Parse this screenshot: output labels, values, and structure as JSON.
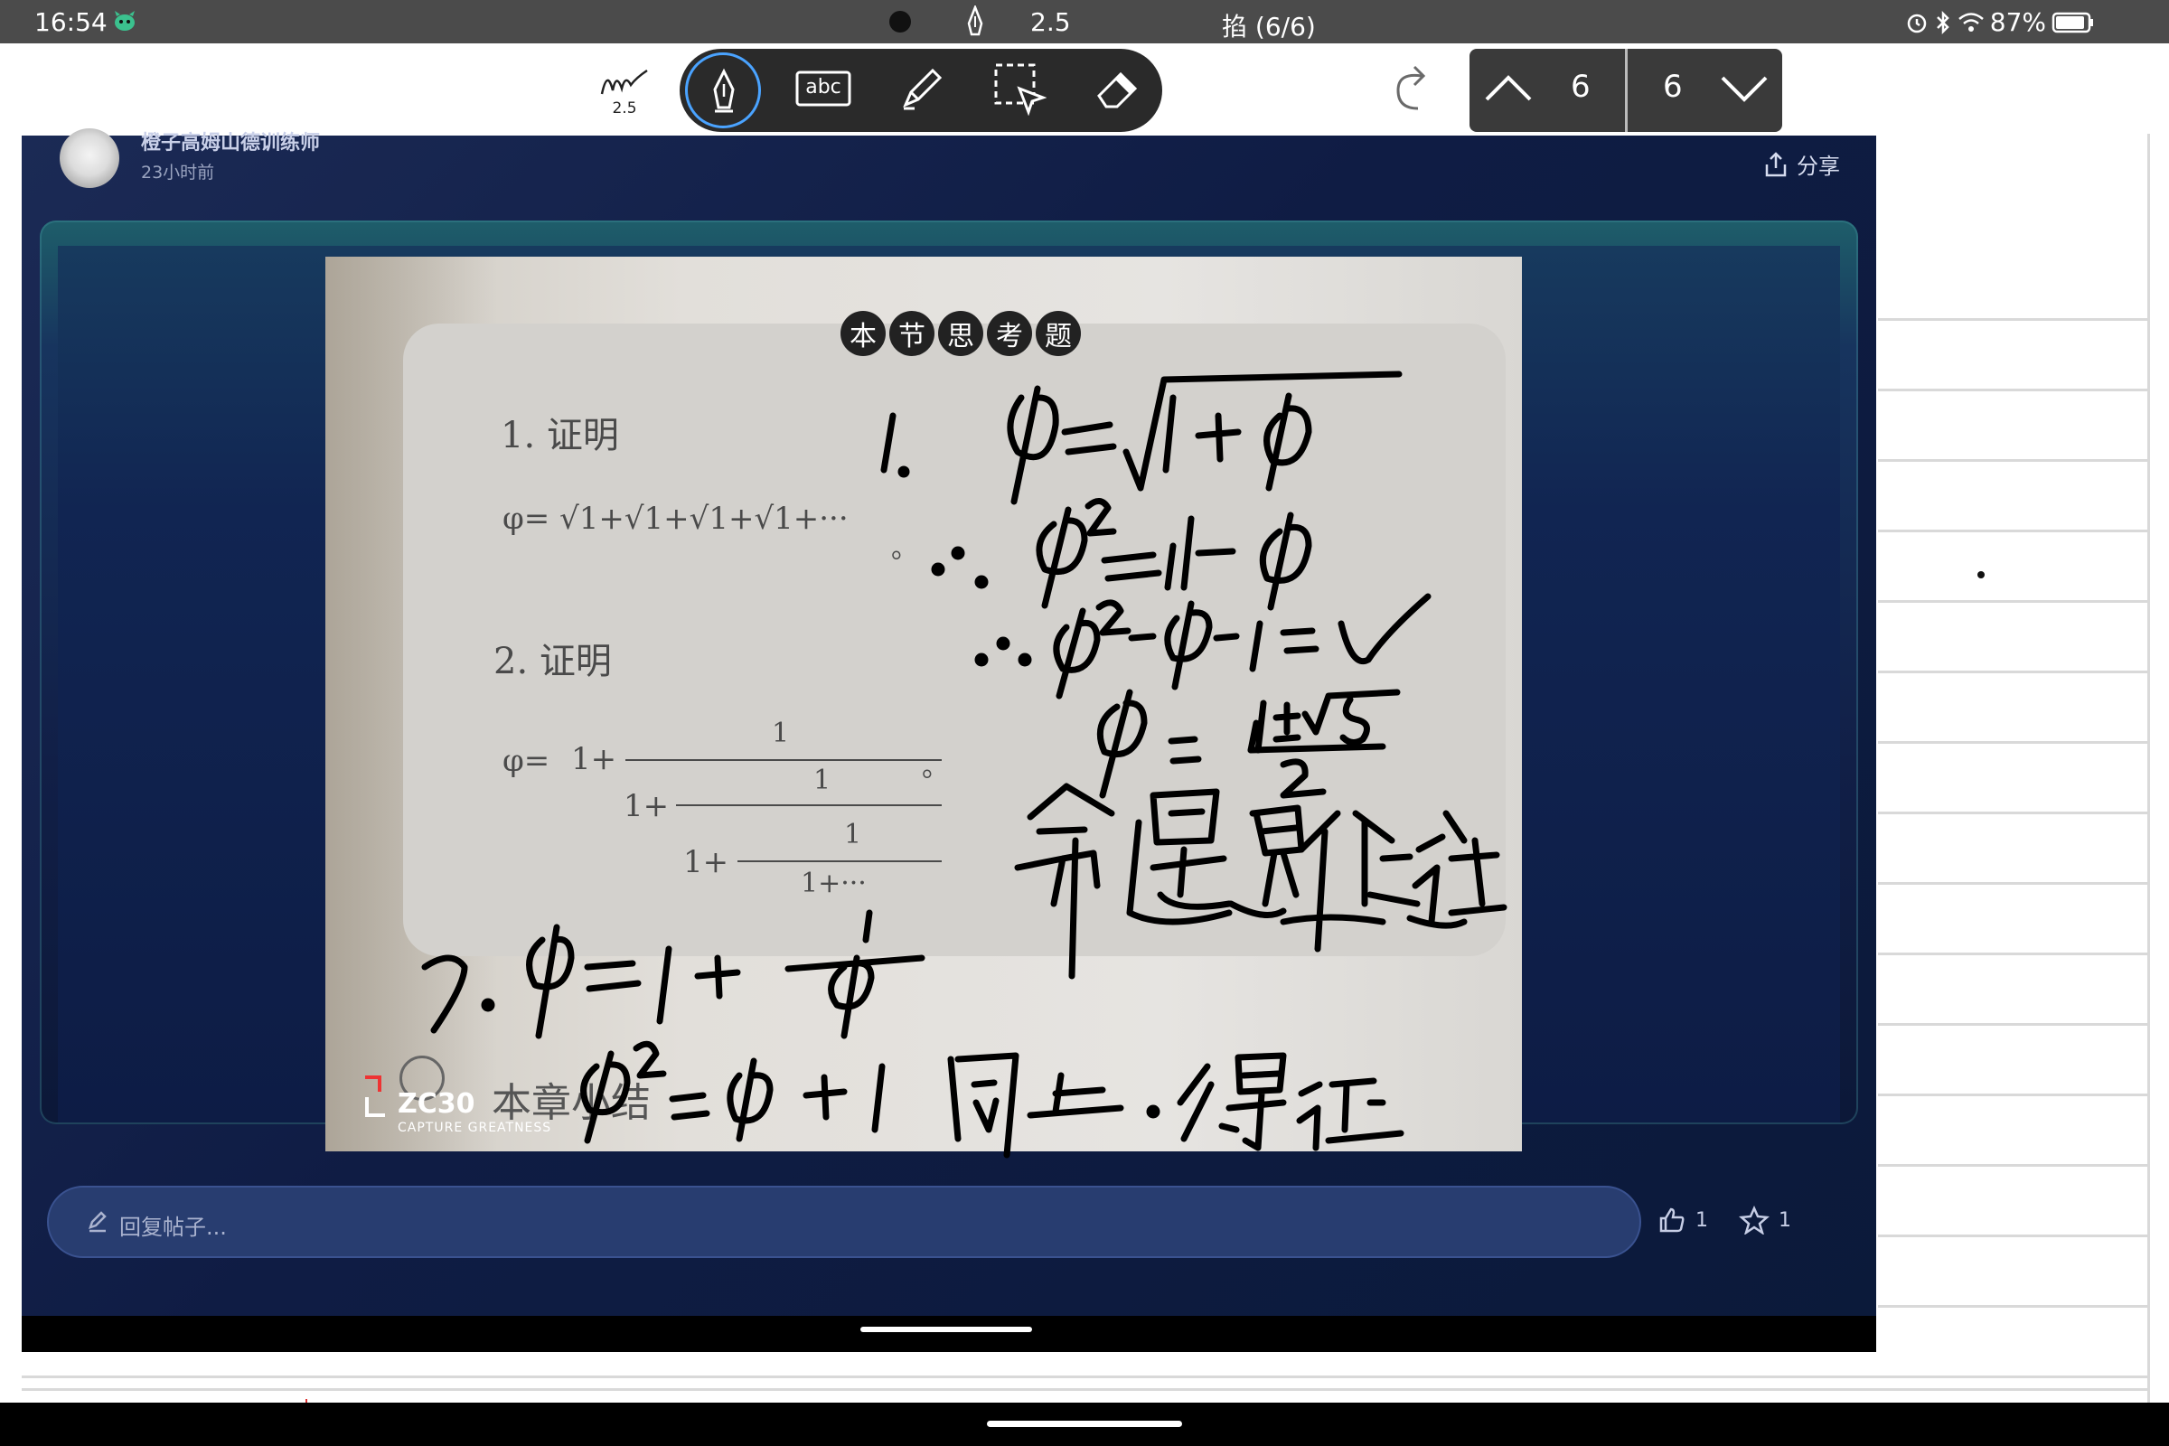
{
  "status_bar": {
    "time": "16:54",
    "pen_size": "2.5",
    "page_indicator": "掐 (6/6)",
    "battery": "87%"
  },
  "toolbar": {
    "pen_size_badge": "2.5",
    "text_tool_label": "abc",
    "current_page": "6",
    "total_pages": "6"
  },
  "post": {
    "author": "橙子高姆山德训练师",
    "time_ago": "23小时前",
    "share_label": "分享",
    "reply_placeholder": "回复帖子...",
    "likes": "1",
    "favorites": "1"
  },
  "photo": {
    "heading_chars": [
      "本",
      "节",
      "思",
      "考",
      "题"
    ],
    "q1_label": "1. 证明",
    "q1_formula": "φ= √1+√1+√1+√1+···",
    "q2_label": "2. 证明",
    "q2_phi": "φ=",
    "q2_one_plus": "1+",
    "q2_one": "1",
    "q2_one_plus_b": "1+",
    "q2_one_b": "1",
    "q2_one_plus_c": "1+",
    "q2_one_c": "1",
    "q2_tail": "1+···",
    "circle_mark": "。",
    "chapter_summary": "本章小结",
    "camera_brand": "ZC30",
    "camera_tagline": "CAPTURE GREATNESS"
  },
  "colors": {
    "accent_blue": "#4aa3ff",
    "toolbar_dark": "#2a2a2a",
    "app_bg": "#0f1c44"
  }
}
